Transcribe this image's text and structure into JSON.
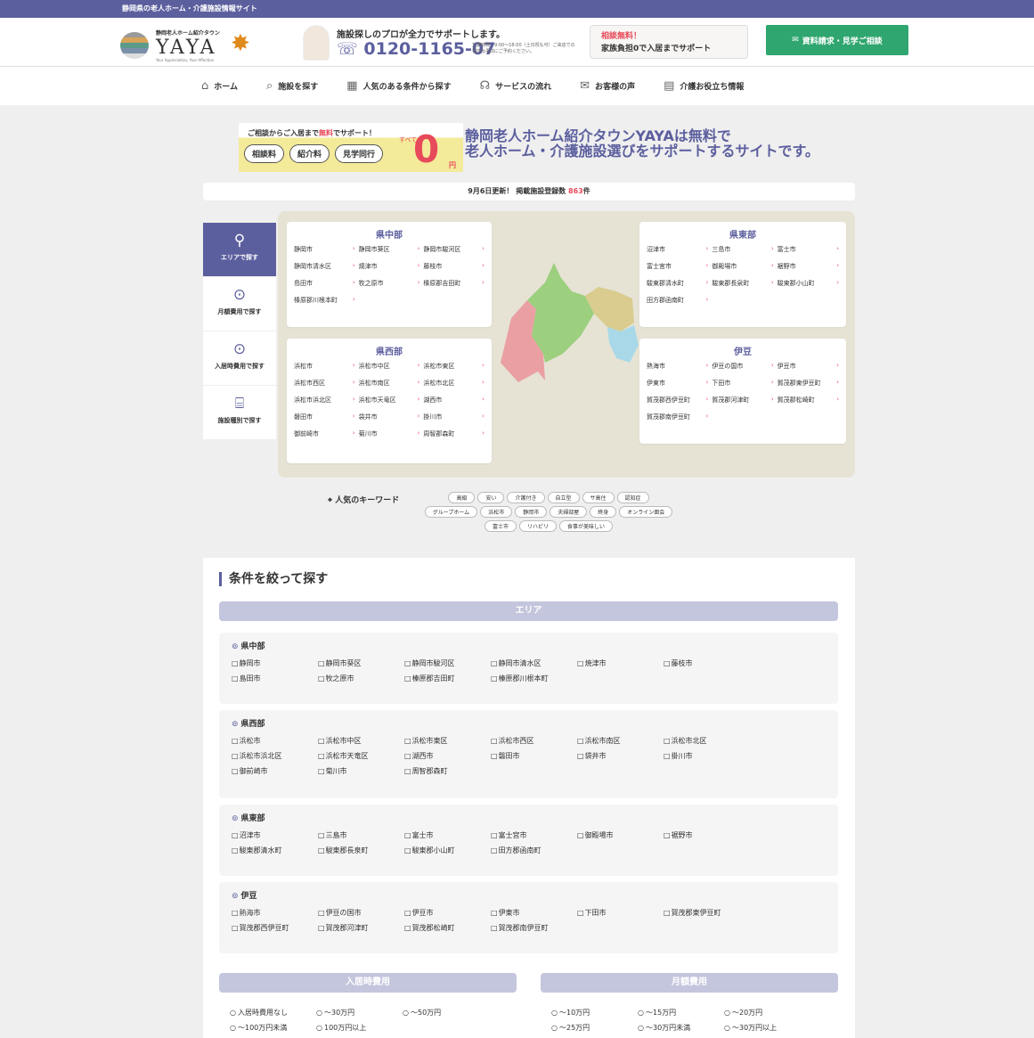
{
  "topbar": {
    "text": "静岡県の老人ホーム・介護施設情報サイト"
  },
  "logo": {
    "sub": "静岡老人ホーム紹介タウン",
    "name": "YAYA",
    "tagline": "Your Appreciation, Your Affection"
  },
  "phone": {
    "lead": "施設探しのプロが全力でサポートします。",
    "number": "0120-1165-07",
    "hours": "営業時間：9:00〜18:00（土日祝も可）ご来店での相談は事前にご予約ください。"
  },
  "banner": {
    "line1": "相談無料！",
    "line2": "家族負担0で入居までサポート"
  },
  "cta": {
    "label": "資料請求・見学ご相談"
  },
  "nav": [
    "ホーム",
    "施設を探す",
    "人気のある条件から探す",
    "サービスの流れ",
    "お客様の声",
    "介護お役立ち情報"
  ],
  "promo": {
    "line1a": "ご相談からご入居まで",
    "line1red": "無料",
    "line1b": "でサポート！",
    "pills": [
      "相談料",
      "紹介料",
      "見学同行"
    ],
    "all": "すべて",
    "zero": "0",
    "yen": "円"
  },
  "hero": {
    "title1": "静岡老人ホーム紹介タウンYAYAは無料で",
    "title2": "老人ホーム・介護施設選びをサポートするサイトです。"
  },
  "update": {
    "prefix": "9月6日更新！ 掲載施設登録数 ",
    "count": "863",
    "suffix": "件"
  },
  "tabs": [
    "エリアで探す",
    "月額費用で探す",
    "入居時費用で探す",
    "施設種別で探す"
  ],
  "regions": {
    "chubu": {
      "title": "県中部",
      "cities": [
        "静岡市",
        "静岡市葵区",
        "静岡市駿河区",
        "静岡市清水区",
        "焼津市",
        "藤枝市",
        "島田市",
        "牧之原市",
        "榛原郡吉田町",
        "榛原郡川根本町"
      ]
    },
    "seibu": {
      "title": "県西部",
      "cities": [
        "浜松市",
        "浜松市中区",
        "浜松市東区",
        "浜松市西区",
        "浜松市南区",
        "浜松市北区",
        "浜松市浜北区",
        "浜松市天竜区",
        "湖西市",
        "磐田市",
        "袋井市",
        "掛川市",
        "御前崎市",
        "菊川市",
        "周智郡森町"
      ]
    },
    "tobu": {
      "title": "県東部",
      "cities": [
        "沼津市",
        "三島市",
        "富士市",
        "富士宮市",
        "御殿場市",
        "裾野市",
        "駿東郡清水町",
        "駿東郡長泉町",
        "駿東郡小山町",
        "田方郡函南町"
      ]
    },
    "izu": {
      "title": "伊豆",
      "cities": [
        "熱海市",
        "伊豆の国市",
        "伊豆市",
        "伊東市",
        "下田市",
        "賀茂郡東伊豆町",
        "賀茂郡西伊豆町",
        "賀茂郡河津町",
        "賀茂郡松崎町",
        "賀茂郡南伊豆町"
      ]
    }
  },
  "keywords": {
    "title": "人気のキーワード",
    "items": [
      "高級",
      "安い",
      "介護付き",
      "自立型",
      "サ高住",
      "認知症",
      "グループホーム",
      "浜松市",
      "静岡市",
      "夫婦部屋",
      "終身",
      "オンライン面会",
      "富士市",
      "リハビリ",
      "食事が美味しい"
    ]
  },
  "search": {
    "title": "条件を絞って探す",
    "area_label": "エリア",
    "areas": [
      {
        "title": "県中部",
        "items": [
          "静岡市",
          "静岡市葵区",
          "静岡市駿河区",
          "静岡市清水区",
          "焼津市",
          "藤枝市",
          "島田市",
          "牧之原市",
          "榛原郡吉田町",
          "榛原郡川根本町"
        ]
      },
      {
        "title": "県西部",
        "items": [
          "浜松市",
          "浜松市中区",
          "浜松市東区",
          "浜松市西区",
          "浜松市南区",
          "浜松市北区",
          "浜松市浜北区",
          "浜松市天竜区",
          "湖西市",
          "磐田市",
          "袋井市",
          "掛川市",
          "御前崎市",
          "菊川市",
          "周智郡森町"
        ]
      },
      {
        "title": "県東部",
        "items": [
          "沼津市",
          "三島市",
          "富士市",
          "富士宮市",
          "御殿場市",
          "裾野市",
          "駿東郡清水町",
          "駿東郡長泉町",
          "駿東郡小山町",
          "田方郡函南町"
        ]
      },
      {
        "title": "伊豆",
        "items": [
          "熱海市",
          "伊豆の国市",
          "伊豆市",
          "伊東市",
          "下田市",
          "賀茂郡東伊豆町",
          "賀茂郡西伊豆町",
          "賀茂郡河津町",
          "賀茂郡松崎町",
          "賀茂郡南伊豆町"
        ]
      }
    ],
    "entry_label": "入居時費用",
    "entry_options": [
      "入居時費用なし",
      "〜30万円",
      "〜50万円",
      "〜100万円未満",
      "100万円以上"
    ],
    "monthly_label": "月額費用",
    "monthly_options": [
      "〜10万円",
      "〜15万円",
      "〜20万円",
      "〜25万円",
      "〜30万円未満",
      "〜30万円以上"
    ]
  },
  "colors": {
    "brand": "#5c5f9e",
    "accent_red": "#e74a5a",
    "cta_green": "#2fa66f",
    "map_chubu": "#9ccf7e",
    "map_seibu": "#ea9fa3",
    "map_tobu": "#d9cc8e",
    "map_izu": "#a9d9e8"
  }
}
